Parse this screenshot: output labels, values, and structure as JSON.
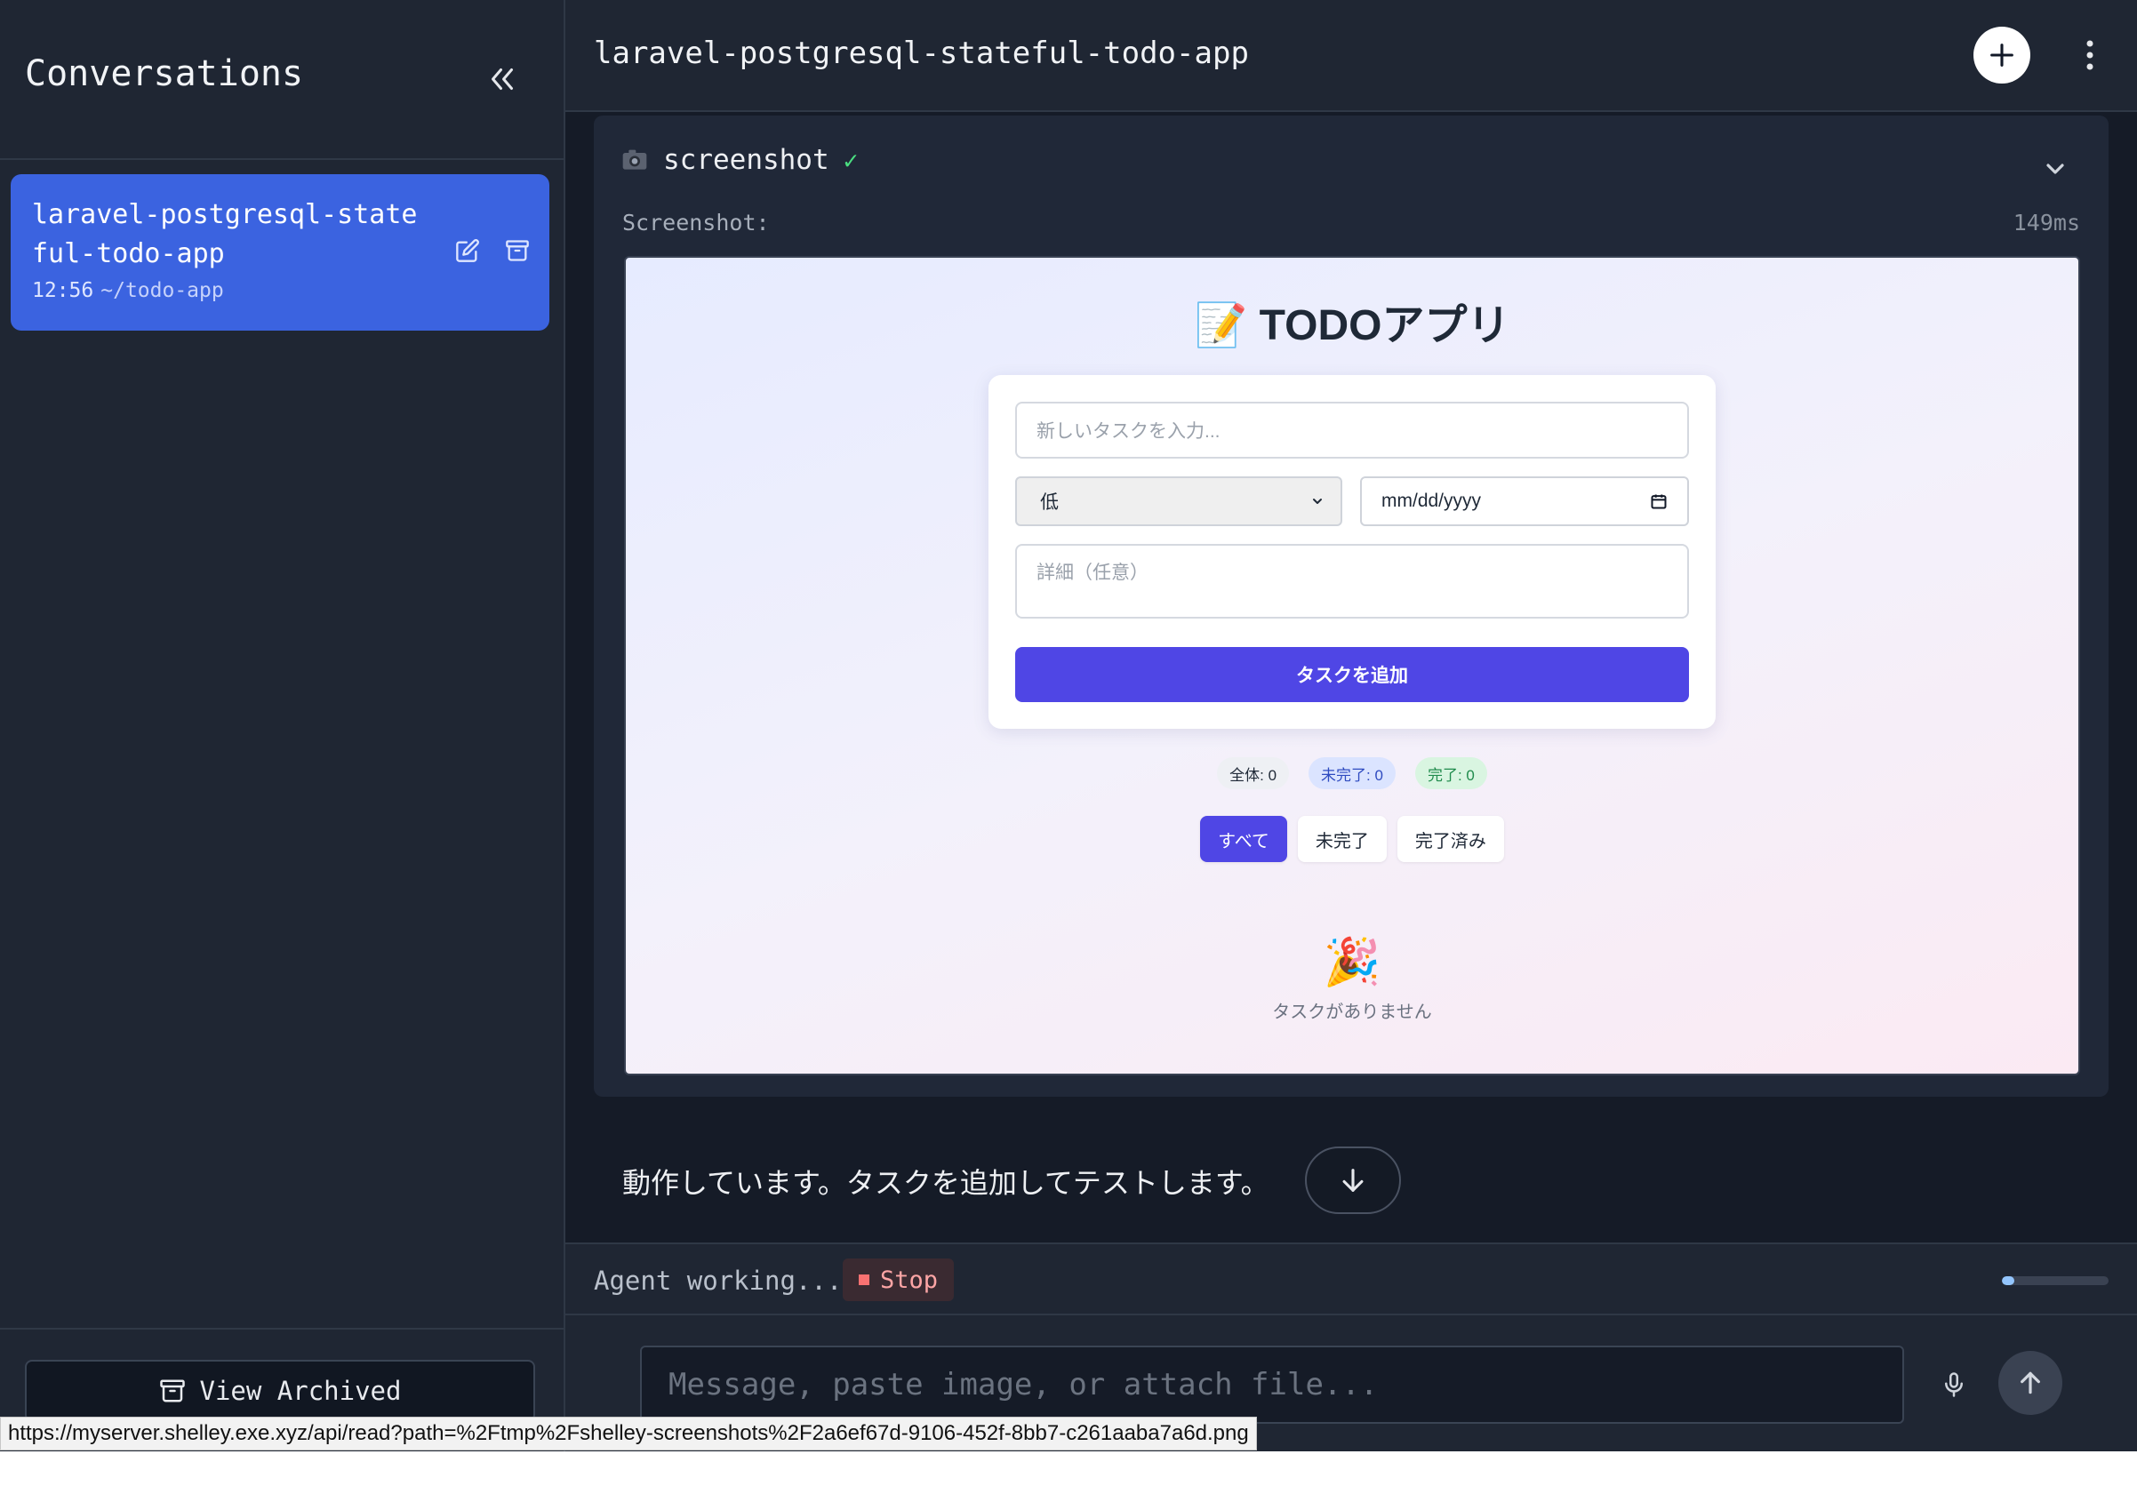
{
  "sidebar": {
    "title": "Conversations",
    "conversations": [
      {
        "name": "laravel-postgresql-stateful-todo-app",
        "time": "12:56",
        "dir": "~/todo-app"
      }
    ],
    "view_archived_label": "View Archived"
  },
  "header": {
    "title": "laravel-postgresql-stateful-todo-app"
  },
  "tool_call": {
    "name": "screenshot",
    "status_mark": "✓",
    "result_label": "Screenshot:",
    "duration": "149ms"
  },
  "todo_app": {
    "title": "📝 TODOアプリ",
    "task_placeholder": "新しいタスクを入力...",
    "priority_value": "低",
    "date_placeholder": "mm/dd/yyyy",
    "detail_placeholder": "詳細（任意）",
    "add_button": "タスクを追加",
    "stats": {
      "all": "全体: 0",
      "incomplete": "未完了: 0",
      "complete": "完了: 0"
    },
    "filters": [
      "すべて",
      "未完了",
      "完了済み"
    ],
    "empty_icon": "🎉",
    "empty_text": "タスクがありません"
  },
  "assistant_message": "動作しています。タスクを追加してテストします。",
  "status": {
    "text": "Agent working...",
    "stop_label": "Stop",
    "progress": 0.12
  },
  "composer": {
    "placeholder": "Message, paste image, or attach file..."
  },
  "tooltip_url": "https://myserver.shelley.exe.xyz/api/read?path=%2Ftmp%2Fshelley-screenshots%2F2a6ef67d-9106-452f-8bb7-c261aaba7a6d.png",
  "colors": {
    "accent": "#3b63e0",
    "app_accent": "#4f46e5",
    "background": "#151b27",
    "panel": "#1f2633"
  }
}
